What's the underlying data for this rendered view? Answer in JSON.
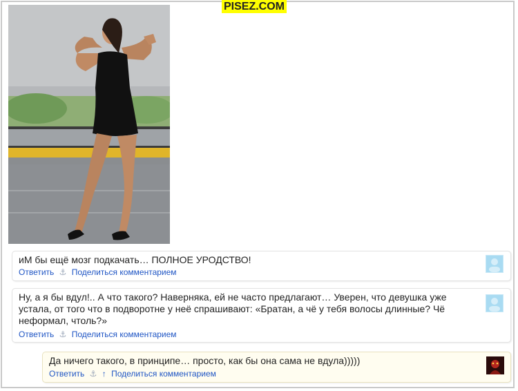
{
  "watermark": "PISEZ.COM",
  "comments": [
    {
      "text": "иМ бы ещё мозг подкачать… ПОЛНОЕ УРОДСТВО!",
      "reply": "Ответить",
      "anchor": "⚓",
      "share": "Поделиться комментарием",
      "avatar": "default-avatar"
    },
    {
      "text": "Ну, а я бы вдул!.. А что такого? Наверняка, ей не часто предлагают… Уверен, что девушка уже устала, от того что в подворотне у неё спрашивают: «Братан, а чё у тебя волосы длинные? Чё неформал, чтоль?»",
      "reply": "Ответить",
      "anchor": "⚓",
      "share": "Поделиться комментарием",
      "avatar": "default-avatar"
    },
    {
      "text": "Да ничего такого, в принципе… просто, как бы она сама не вдула)))))",
      "reply": "Ответить",
      "anchor": "⚓",
      "up": "↑",
      "share": "Поделиться комментарием",
      "avatar": "user-avatar"
    }
  ],
  "colors": {
    "link": "#1f55c4",
    "avatar_default": "#a9dbf2",
    "reply_background": "#fffdf0"
  }
}
